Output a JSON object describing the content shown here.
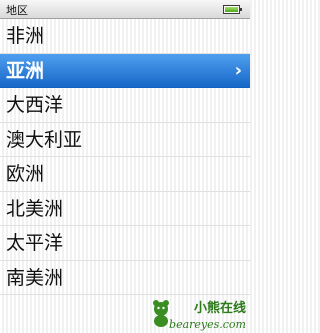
{
  "header": {
    "title": "地区",
    "battery_level": 1.0
  },
  "menu": {
    "items": [
      {
        "label": "非洲",
        "selected": false
      },
      {
        "label": "亚洲",
        "selected": true
      },
      {
        "label": "大西洋",
        "selected": false
      },
      {
        "label": "澳大利亚",
        "selected": false
      },
      {
        "label": "欧洲",
        "selected": false
      },
      {
        "label": "北美洲",
        "selected": false
      },
      {
        "label": "太平洋",
        "selected": false
      },
      {
        "label": "南美洲",
        "selected": false
      }
    ],
    "chevron": "›"
  },
  "watermark": {
    "line1": "小熊在线",
    "line2": "beareyes.com",
    "color": "#2c7a1a"
  }
}
